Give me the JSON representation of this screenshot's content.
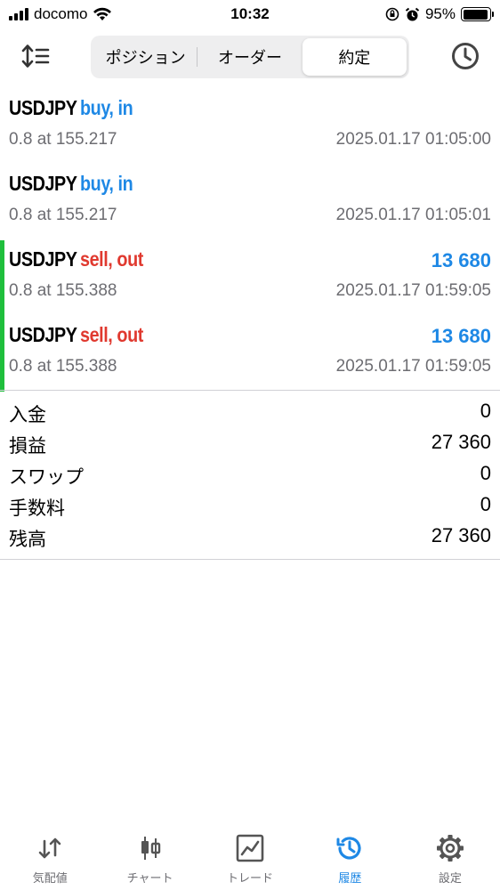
{
  "status_bar": {
    "carrier": "docomo",
    "time": "10:32",
    "battery": "95%"
  },
  "segments": [
    {
      "label": "ポジション"
    },
    {
      "label": "オーダー"
    },
    {
      "label": "約定"
    }
  ],
  "deals": [
    {
      "symbol": "USDJPY",
      "side": "buy, in",
      "detail": "0.8 at 155.217",
      "time": "2025.01.17 01:05:00",
      "profit": ""
    },
    {
      "symbol": "USDJPY",
      "side": "buy, in",
      "detail": "0.8 at 155.217",
      "time": "2025.01.17 01:05:01",
      "profit": ""
    },
    {
      "symbol": "USDJPY",
      "side": "sell, out",
      "detail": "0.8 at 155.388",
      "time": "2025.01.17 01:59:05",
      "profit": "13 680"
    },
    {
      "symbol": "USDJPY",
      "side": "sell, out",
      "detail": "0.8 at 155.388",
      "time": "2025.01.17 01:59:05",
      "profit": "13 680"
    }
  ],
  "summary": [
    {
      "label": "入金",
      "value": "0"
    },
    {
      "label": "損益",
      "value": "27 360"
    },
    {
      "label": "スワップ",
      "value": "0"
    },
    {
      "label": "手数料",
      "value": "0"
    },
    {
      "label": "残高",
      "value": "27 360"
    }
  ],
  "tabs": [
    {
      "label": "気配値",
      "icon": "quotes-arrows-icon"
    },
    {
      "label": "チャート",
      "icon": "candlestick-chart-icon"
    },
    {
      "label": "トレード",
      "icon": "trade-chart-icon"
    },
    {
      "label": "履歴",
      "icon": "history-clock-icon"
    },
    {
      "label": "設定",
      "icon": "settings-gear-icon"
    }
  ],
  "colors": {
    "accent": "#1e88e5",
    "sell": "#e0392f",
    "closed_marker": "#1fbf3c",
    "secondary_text": "#6d6d72"
  }
}
